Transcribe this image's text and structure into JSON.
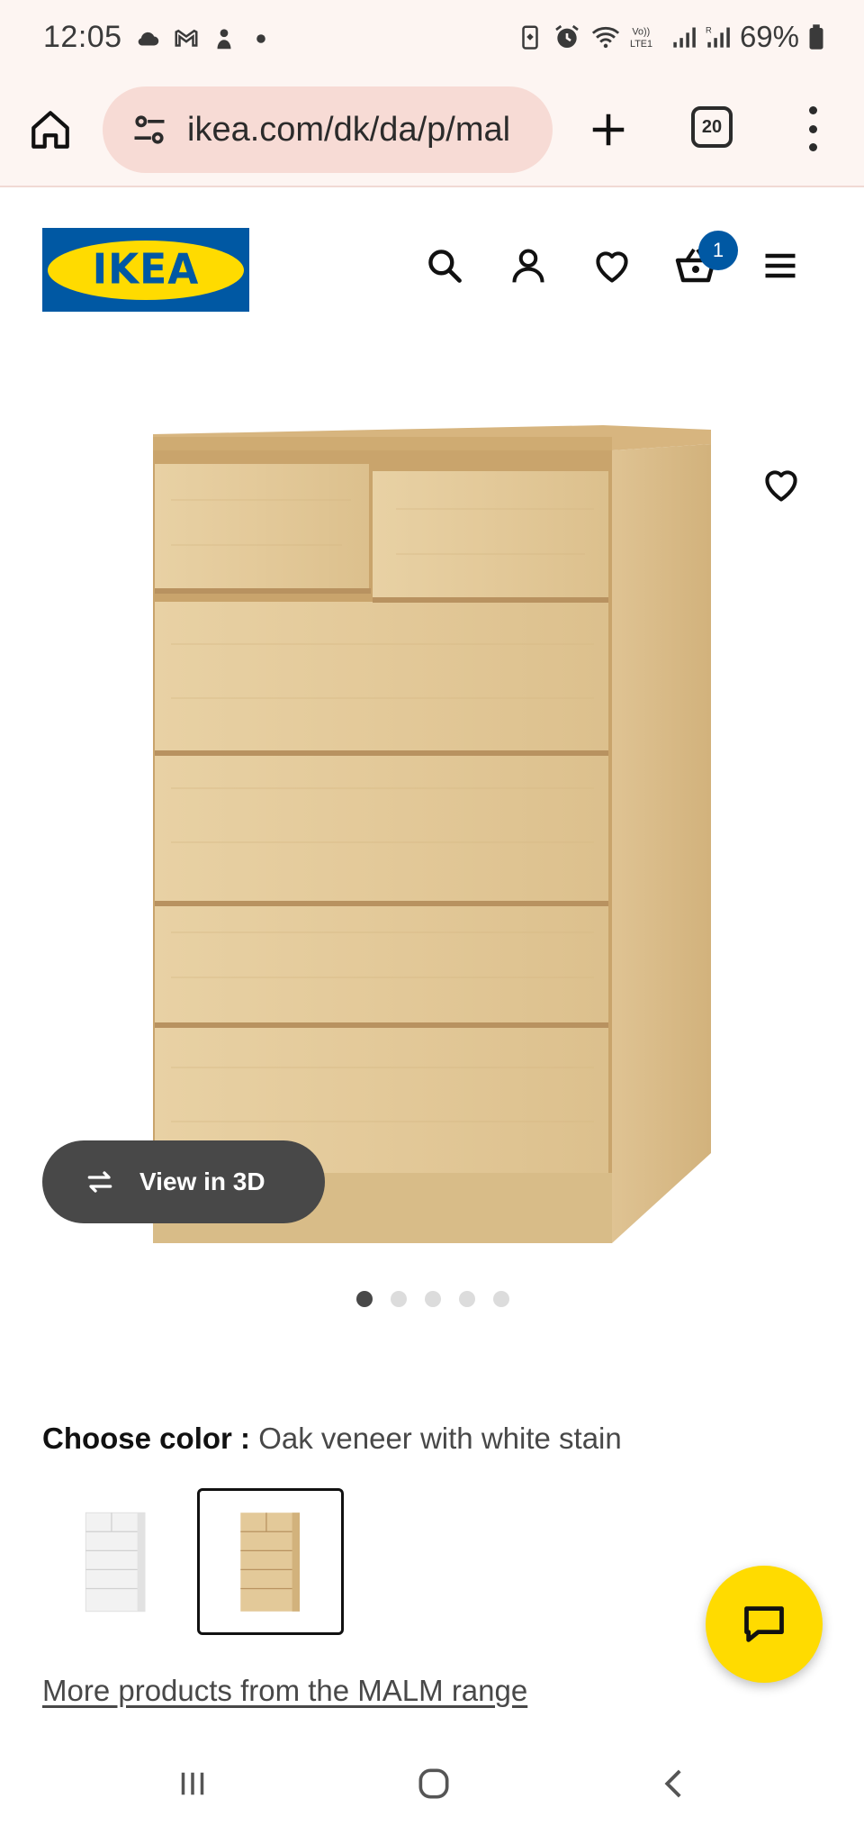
{
  "status_bar": {
    "time": "12:05",
    "battery": "69%",
    "left_icons": [
      "cloud-icon",
      "gmail-icon",
      "app-icon",
      "dot-icon"
    ],
    "right_icons": [
      "battery-saver-icon",
      "alarm-icon",
      "wifi-icon",
      "volte-icon",
      "signal-icon",
      "signal-r-icon",
      "battery-icon"
    ]
  },
  "browser": {
    "url": "ikea.com/dk/da/p/mal",
    "tab_count": "20",
    "icons": [
      "home-icon",
      "tune-icon",
      "plus-icon",
      "tabs-icon",
      "more-vert-icon"
    ]
  },
  "header": {
    "logo_text": "IKEA",
    "cart_count": "1",
    "icons": [
      "search-icon",
      "account-icon",
      "heart-icon",
      "cart-icon",
      "hamburger-icon"
    ]
  },
  "product": {
    "view3d_label": "View in 3D",
    "image_count": 5,
    "active_image": 1
  },
  "color": {
    "label": "Choose color :",
    "value": "Oak veneer with white stain",
    "options": [
      "White",
      "Oak veneer with white stain"
    ],
    "selected": 1
  },
  "range_link": "More products from the MALM range",
  "colors": {
    "ikea_blue": "#0058a3",
    "ikea_yellow": "#ffdb00",
    "browser_bg": "#fdf5f2",
    "url_pill": "#f7dbd5"
  }
}
